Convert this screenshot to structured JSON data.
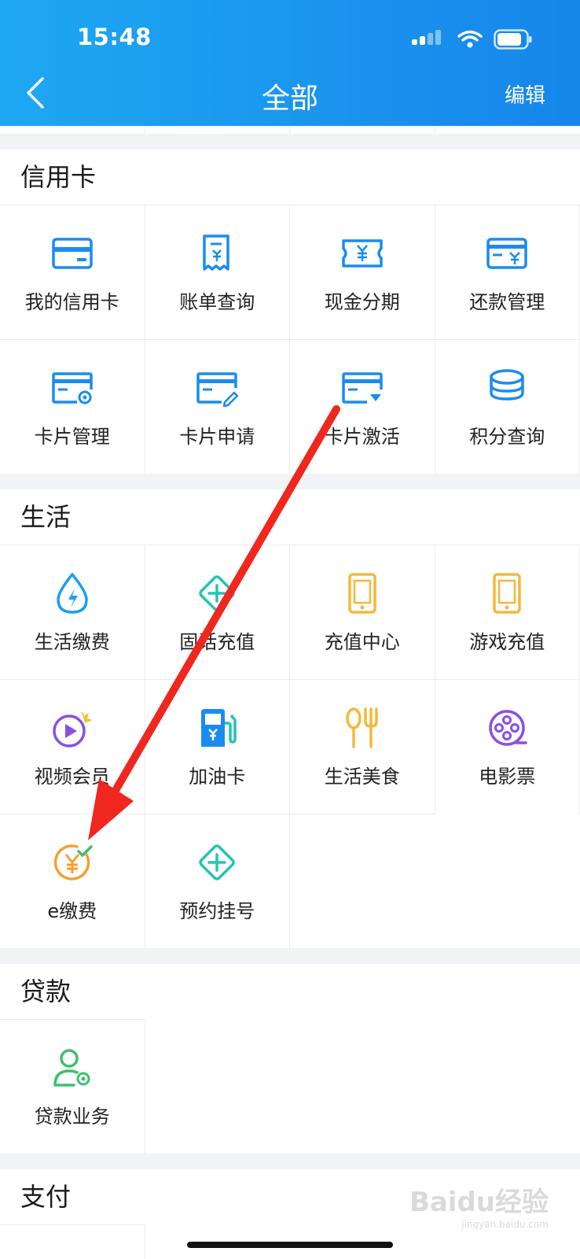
{
  "status_bar": {
    "time": "15:48"
  },
  "nav": {
    "title": "全部",
    "edit_label": "编辑"
  },
  "sections": [
    {
      "title": "信用卡",
      "items": [
        {
          "label": "我的信用卡",
          "icon": "credit-card-icon"
        },
        {
          "label": "账单查询",
          "icon": "bill-receipt-icon"
        },
        {
          "label": "现金分期",
          "icon": "cash-ticket-icon"
        },
        {
          "label": "还款管理",
          "icon": "card-repay-icon"
        },
        {
          "label": "卡片管理",
          "icon": "card-settings-icon"
        },
        {
          "label": "卡片申请",
          "icon": "card-apply-icon"
        },
        {
          "label": "卡片激活",
          "icon": "card-activate-icon"
        },
        {
          "label": "积分查询",
          "icon": "coins-stack-icon"
        }
      ]
    },
    {
      "title": "生活",
      "items": [
        {
          "label": "生活缴费",
          "icon": "water-drop-bolt-icon"
        },
        {
          "label": "固话充值",
          "icon": "diamond-plus-icon"
        },
        {
          "label": "充值中心",
          "icon": "phone-icon"
        },
        {
          "label": "游戏充值",
          "icon": "phone-icon"
        },
        {
          "label": "视频会员",
          "icon": "video-play-icon"
        },
        {
          "label": "加油卡",
          "icon": "fuel-pump-icon"
        },
        {
          "label": "生活美食",
          "icon": "spoon-fork-icon"
        },
        {
          "label": "电影票",
          "icon": "film-reel-icon"
        },
        {
          "label": "e缴费",
          "icon": "yen-check-icon"
        },
        {
          "label": "预约挂号",
          "icon": "diamond-plus-icon"
        }
      ]
    },
    {
      "title": "贷款",
      "items": [
        {
          "label": "贷款业务",
          "icon": "user-gear-icon"
        }
      ]
    },
    {
      "title": "支付",
      "items": []
    }
  ],
  "watermark": {
    "brand": "Baidu经验",
    "url": "jingyan.baidu.com"
  },
  "colors": {
    "header_start": "#1ea8f2",
    "header_end": "#1686ea",
    "card_blue": "#1a8cf0",
    "life_orange": "#f5b83a",
    "teal": "#24c4b4",
    "purple": "#8a4fe0",
    "green": "#3cc06a",
    "annotation_arrow": "#f0271e"
  }
}
